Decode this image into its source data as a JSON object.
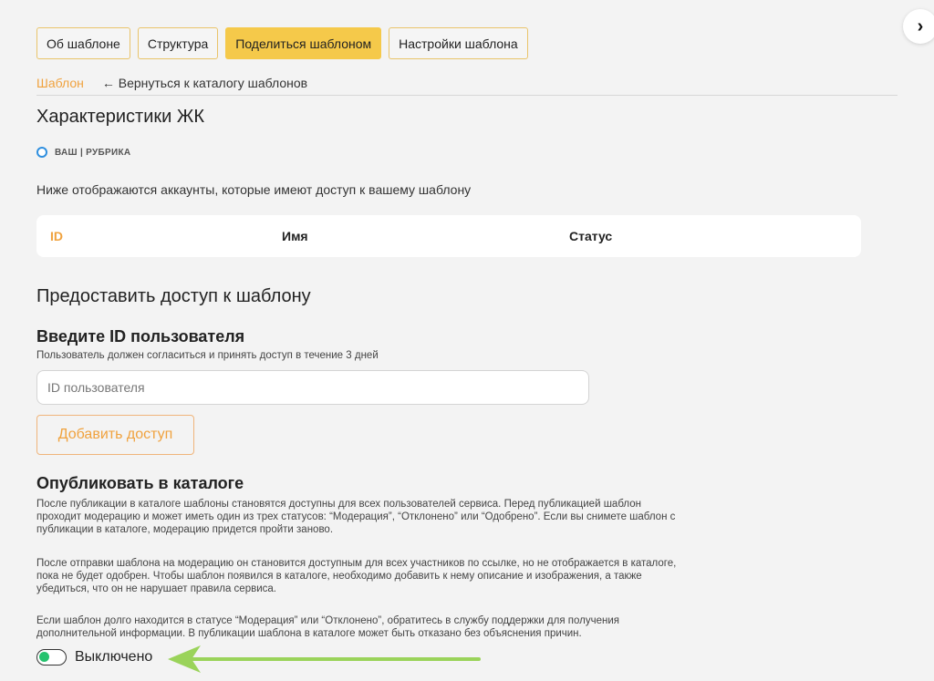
{
  "tabs": [
    {
      "label": "Об шаблоне",
      "active": false
    },
    {
      "label": "Структура",
      "active": false
    },
    {
      "label": "Поделиться шаблоном",
      "active": true
    },
    {
      "label": "Настройки шаблона",
      "active": false
    }
  ],
  "next_icon": "chevron-right-icon",
  "breadcrumb": {
    "current": "Шаблон",
    "back": "← Вернуться к каталогу шаблонов"
  },
  "page_title": "Характеристики ЖК",
  "tag": {
    "text": "ВАШ | РУБРИКА",
    "dot_color": "#2f8fdf"
  },
  "access_description": "Ниже отображаются аккаунты, которые имеют доступ к вашему шаблону",
  "table": {
    "columns": [
      "ID",
      "Имя",
      "Статус"
    ],
    "rows": []
  },
  "grant": {
    "title": "Предоставить доступ к шаблону",
    "input_title": "Введите ID пользователя",
    "input_hint": "Пользователь должен согласиться и принять доступ в течение 3 дней",
    "input_placeholder": "ID пользователя",
    "input_value": "",
    "add_button": "Добавить доступ"
  },
  "publish": {
    "title": "Опубликовать в каталоге",
    "paragraphs": [
      "После публикации в каталоге шаблоны становятся доступны для всех пользователей сервиса. Перед публикацией шаблон проходит модерацию и может иметь один из трех статусов: “Модерация”, “Отклонено” или “Одобрено”. Если вы снимете шаблон с публикации в каталоге, модерацию придется пройти заново.",
      "После отправки шаблона на модерацию он становится доступным для всех участников по ссылке, но не отображается в каталоге, пока не будет одобрен. Чтобы шаблон появился в каталоге, необходимо добавить к нему описание и изображения, а также убедиться, что он не нарушает правила сервиса.",
      "Если шаблон долго находится в статусе “Модерация” или “Отклонено”, обратитесь в службу поддержки для получения дополнительной информации. В публикации шаблона в каталоге может быть отказано без объяснения причин."
    ],
    "toggle_label": "Выключено",
    "toggle_on": false
  },
  "colors": {
    "accent": "#f0a23e",
    "active_tab": "#f5c94a",
    "toggle_knob": "#25c26e",
    "annotation_arrow": "#9ad35a"
  }
}
